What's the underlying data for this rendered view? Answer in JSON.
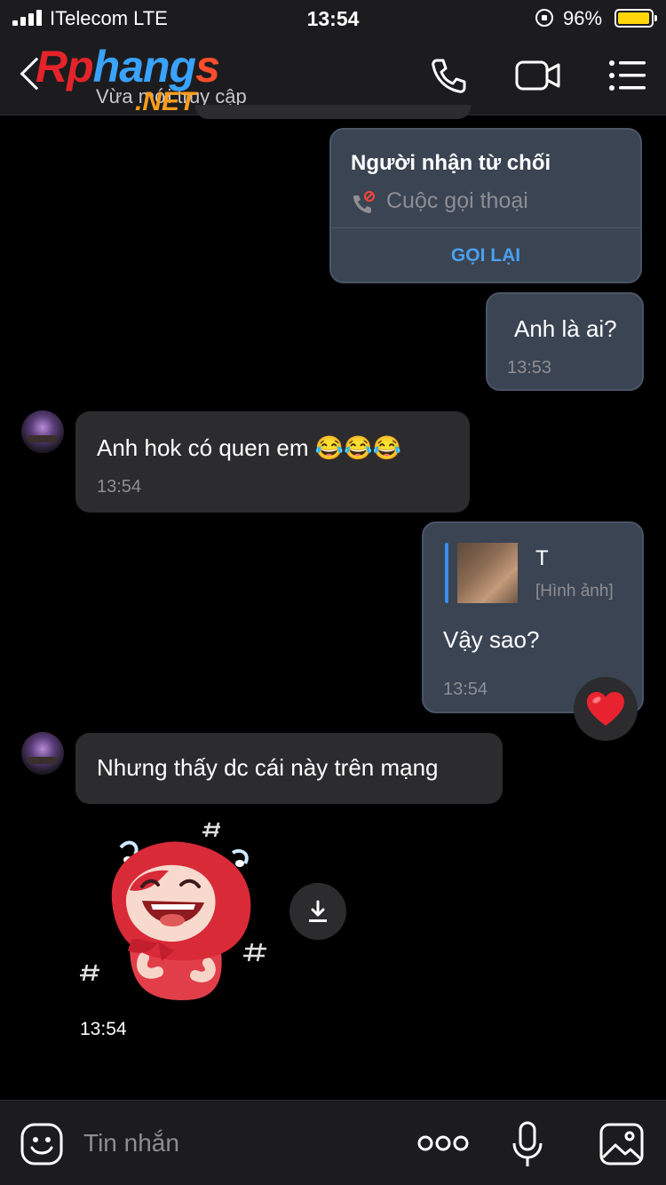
{
  "status_bar": {
    "carrier": "ITelecom  LTE",
    "time": "13:54",
    "battery": "96%",
    "battery_level": 0.96
  },
  "header": {
    "logo_part1": "Rp",
    "logo_part2": "hang",
    "logo_part3": "s",
    "logo_net": ".NET",
    "subtitle": "Vừa mới truy cập",
    "icons": [
      "back-chevron-icon",
      "phone-icon",
      "video-camera-icon",
      "list-menu-icon"
    ]
  },
  "messages": {
    "call": {
      "title": "Người nhận từ chối",
      "subtitle": "Cuộc gọi thoại",
      "action": "GỌI LẠI"
    },
    "m1": {
      "text": "Anh là ai?",
      "time": "13:53"
    },
    "m2": {
      "text": "Anh hok có quen em 😂😂😂",
      "time": "13:54"
    },
    "m3": {
      "reply_name": "T",
      "reply_type": "[Hình ảnh]",
      "text": "Vậy sao?",
      "time": "13:54",
      "reaction": "heart"
    },
    "m4": {
      "text": "Nhưng thấy dc cái này trên mạng"
    },
    "sticker": {
      "time": "13:54",
      "icon": "laughing-girl-sticker"
    }
  },
  "input": {
    "placeholder": "Tin nhắn"
  },
  "colors": {
    "outgoing_bubble": "#3a4453",
    "incoming_bubble": "#2c2c2e",
    "accent": "#4aa0f0",
    "battery": "#ffd60a"
  }
}
